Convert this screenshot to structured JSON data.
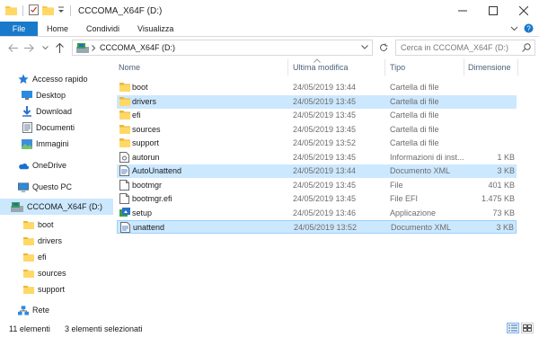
{
  "window": {
    "title": "CCCOMA_X64F (D:)"
  },
  "ribbon": {
    "tabs": [
      "File",
      "Home",
      "Condividi",
      "Visualizza"
    ]
  },
  "address": {
    "path": "CCCOMA_X64F (D:)",
    "search_placeholder": "Cerca in CCCOMA_X64F (D:)"
  },
  "sidebar": {
    "quick_access": "Accesso rapido",
    "pinned": [
      "Desktop",
      "Download",
      "Documenti",
      "Immagini"
    ],
    "onedrive": "OneDrive",
    "this_pc": "Questo PC",
    "drive": "CCCOMA_X64F (D:)",
    "drive_children": [
      "boot",
      "drivers",
      "efi",
      "sources",
      "support"
    ],
    "network": "Rete"
  },
  "columns": {
    "name": "Nome",
    "modified": "Ultima modifica",
    "type": "Tipo",
    "size": "Dimensione"
  },
  "files": [
    {
      "name": "boot",
      "modified": "24/05/2019 13:44",
      "type": "Cartella di file",
      "size": "",
      "icon": "folder-icon",
      "selected": false
    },
    {
      "name": "drivers",
      "modified": "24/05/2019 13:45",
      "type": "Cartella di file",
      "size": "",
      "icon": "folder-icon",
      "selected": true
    },
    {
      "name": "efi",
      "modified": "24/05/2019 13:45",
      "type": "Cartella di file",
      "size": "",
      "icon": "folder-icon",
      "selected": false
    },
    {
      "name": "sources",
      "modified": "24/05/2019 13:45",
      "type": "Cartella di file",
      "size": "",
      "icon": "folder-icon",
      "selected": false
    },
    {
      "name": "support",
      "modified": "24/05/2019 13:52",
      "type": "Cartella di file",
      "size": "",
      "icon": "folder-icon",
      "selected": false
    },
    {
      "name": "autorun",
      "modified": "24/05/2019 13:45",
      "type": "Informazioni di inst...",
      "size": "1 KB",
      "icon": "settings-file-icon",
      "selected": false
    },
    {
      "name": "AutoUnattend",
      "modified": "24/05/2019 13:44",
      "type": "Documento XML",
      "size": "3 KB",
      "icon": "xml-file-icon",
      "selected": true
    },
    {
      "name": "bootmgr",
      "modified": "24/05/2019 13:45",
      "type": "File",
      "size": "401 KB",
      "icon": "file-icon",
      "selected": false
    },
    {
      "name": "bootmgr.efi",
      "modified": "24/05/2019 13:45",
      "type": "File EFI",
      "size": "1.475 KB",
      "icon": "file-icon",
      "selected": false
    },
    {
      "name": "setup",
      "modified": "24/05/2019 13:46",
      "type": "Applicazione",
      "size": "73 KB",
      "icon": "setup-app-icon",
      "selected": false
    },
    {
      "name": "unattend",
      "modified": "24/05/2019 13:52",
      "type": "Documento XML",
      "size": "3 KB",
      "icon": "xml-file-icon",
      "selected": true
    }
  ],
  "status": {
    "count": "11 elementi",
    "selection": "3 elementi selezionati"
  },
  "colors": {
    "accent": "#1979ca",
    "selection": "#cce8ff",
    "folder": "#f5c94a"
  }
}
